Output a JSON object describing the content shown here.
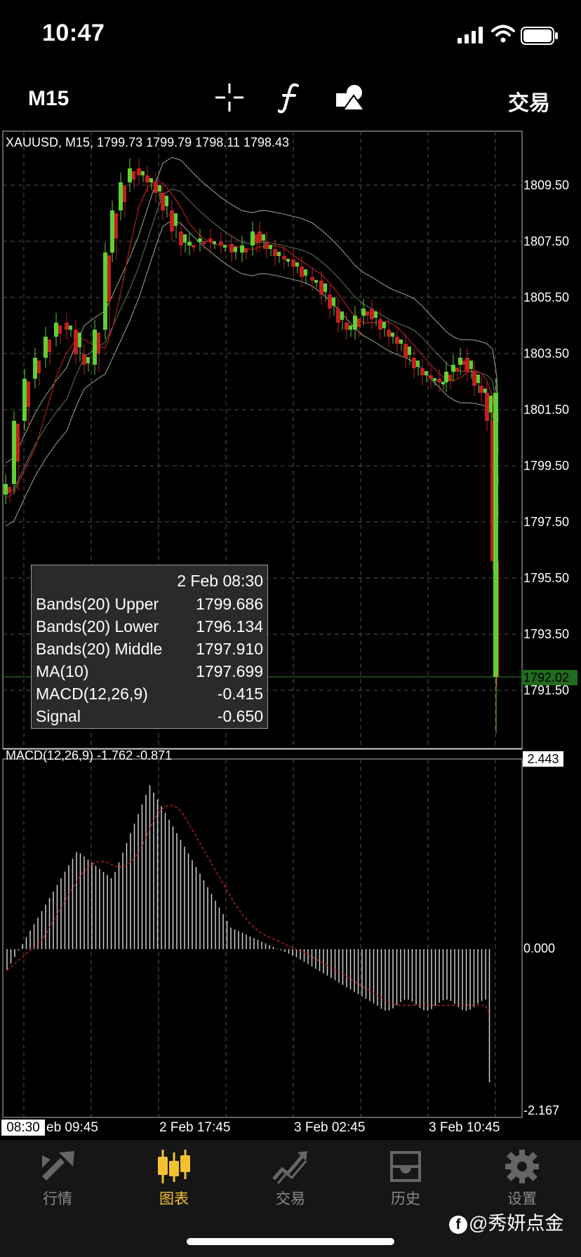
{
  "status_bar": {
    "time": "10:47"
  },
  "toolbar": {
    "timeframe": "M15",
    "trade": "交易"
  },
  "chart": {
    "header": "XAUUSD, M15, 1799.73 1799.79 1798.11 1798.43",
    "price_labels": [
      "1809.50",
      "1807.50",
      "1805.50",
      "1803.50",
      "1801.50",
      "1799.50",
      "1797.50",
      "1795.50",
      "1793.50",
      "1791.50"
    ],
    "current_price": "1792.02",
    "macd_header": "MACD(12,26,9) -1.762 -0.871",
    "macd_max": "2.443",
    "macd_zero": "0.000",
    "macd_min": "-2.167",
    "time_labels": [
      "eb 09:45",
      "2 Feb 17:45",
      "3 Feb 02:45",
      "3 Feb 10:45"
    ],
    "time_box": "08:30"
  },
  "tooltip": {
    "date": "2 Feb 08:30",
    "rows": [
      {
        "label": "Bands(20) Upper",
        "value": "1799.686"
      },
      {
        "label": "Bands(20) Lower",
        "value": "1796.134"
      },
      {
        "label": "Bands(20) Middle",
        "value": "1797.910"
      },
      {
        "label": "MA(10)",
        "value": "1797.699"
      },
      {
        "label": "MACD(12,26,9)",
        "value": "-0.415"
      },
      {
        "label": "Signal",
        "value": "-0.650"
      }
    ]
  },
  "tabs": [
    {
      "label": "行情",
      "icon": "quotes-icon",
      "active": false
    },
    {
      "label": "图表",
      "icon": "chart-icon",
      "active": true
    },
    {
      "label": "交易",
      "icon": "trade-icon",
      "active": false
    },
    {
      "label": "历史",
      "icon": "history-icon",
      "active": false
    },
    {
      "label": "设置",
      "icon": "settings-icon",
      "active": false
    }
  ],
  "watermark": "@秀妍点金",
  "colors": {
    "bull": "#5fd030",
    "bear": "#c02020",
    "accent": "#f2c230",
    "grid": "#555555"
  }
}
